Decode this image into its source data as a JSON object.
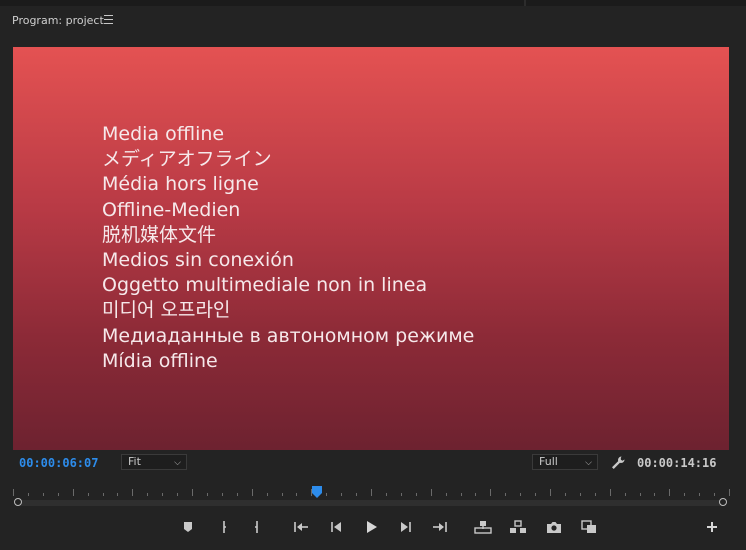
{
  "panel": {
    "title": "Program: project",
    "menu_icon": "hamburger-menu-icon"
  },
  "viewer": {
    "background_top": "#e45252",
    "background_bottom": "#6d2230",
    "offline_messages": [
      "Media offline",
      "メディアオフライン",
      "Média hors ligne",
      "Offline-Medien",
      "脱机媒体文件",
      "Medios sin conexión",
      "Oggetto multimediale non in linea",
      "미디어 오프라인",
      "Медиаданные в автономном режиме",
      "Mídia offline"
    ]
  },
  "controls": {
    "current_timecode": "00:00:06:07",
    "zoom_select": "Fit",
    "resolution_select": "Full",
    "duration_timecode": "00:00:14:16",
    "settings_icon": "wrench-icon"
  },
  "colors": {
    "accent_blue": "#2d8ceb",
    "panel_bg": "#232323"
  },
  "transport_buttons": [
    "add-marker-icon",
    "mark-in-icon",
    "mark-out-icon",
    "go-to-in-icon",
    "step-back-icon",
    "play-icon",
    "step-forward-icon",
    "go-to-out-icon",
    "lift-icon",
    "extract-icon",
    "export-frame-icon",
    "compare-view-icon",
    "button-editor-plus-icon"
  ]
}
